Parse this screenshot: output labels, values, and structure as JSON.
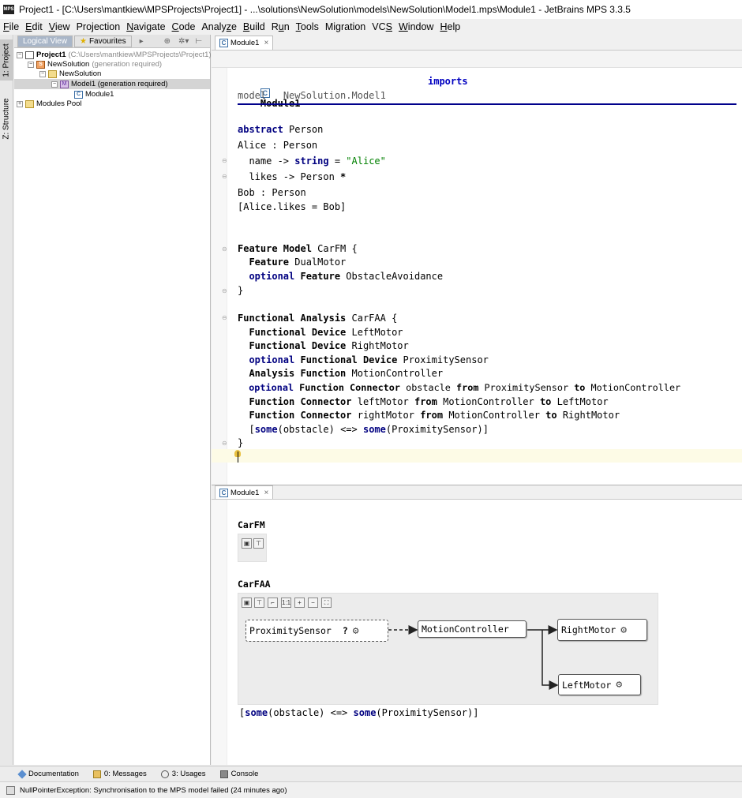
{
  "window": {
    "app_icon": "MPS",
    "title": "Project1 - [C:\\Users\\mantkiew\\MPSProjects\\Project1] - ...\\solutions\\NewSolution\\models\\NewSolution\\Model1.mps\\Module1 - JetBrains MPS 3.3.5"
  },
  "menu": [
    {
      "mn": "F",
      "rest": "ile"
    },
    {
      "mn": "E",
      "rest": "dit"
    },
    {
      "mn": "V",
      "rest": "iew"
    },
    {
      "pre": "Projection",
      "mn": "",
      "rest": ""
    },
    {
      "mn": "N",
      "rest": "avigate"
    },
    {
      "mn": "C",
      "rest": "ode"
    },
    {
      "pre": "Analy",
      "mn": "z",
      "rest": "e"
    },
    {
      "mn": "B",
      "rest": "uild"
    },
    {
      "pre": "R",
      "mn": "u",
      "rest": "n"
    },
    {
      "mn": "T",
      "rest": "ools"
    },
    {
      "pre": "Migration",
      "mn": "",
      "rest": ""
    },
    {
      "pre": "VC",
      "mn": "S",
      "rest": ""
    },
    {
      "mn": "W",
      "rest": "indow"
    },
    {
      "mn": "H",
      "rest": "elp"
    }
  ],
  "left_strip": {
    "project_tab": "1: Project",
    "structure_tab": "Z: Structure"
  },
  "project_panel": {
    "tabs": {
      "logical": "Logical View",
      "favourites": "Favourites"
    },
    "tools": {
      "nav": "▸",
      "locate": "⊕",
      "settings": "✲▾",
      "hide": "⊢"
    },
    "tree": {
      "project": {
        "name": "Project1",
        "path": "(C:\\Users\\mantkiew\\MPSProjects\\Project1)"
      },
      "solution": {
        "name": "NewSolution",
        "note": "(generation required)",
        "icon_letter": "S"
      },
      "folder": {
        "name": "NewSolution"
      },
      "model": {
        "name": "Model1 (generation required)",
        "icon_letter": "M"
      },
      "module": {
        "name": "Module1",
        "icon_letter": "C"
      },
      "modules_pool": {
        "name": "Modules Pool"
      }
    }
  },
  "editor_top": {
    "tab_label": "Module1",
    "tab_icon": "C",
    "close": "×",
    "header": {
      "name": "Module1",
      "imports": "imports",
      "model_kw": "model",
      "model_name": "NewSolution.Model1"
    },
    "lines": {
      "l1_kw": "abstract",
      "l1_rest": " Person",
      "l2": "Alice : Person",
      "l3_a": "  name -> ",
      "l3_kw": "string",
      "l3_b": " = ",
      "l3_str": "\"Alice\"",
      "l4_a": "  likes -> Person ",
      "l4_star": "*",
      "l5": "Bob : Person",
      "l6": "[Alice.likes = Bob]",
      "fm1_kw": "Feature Model",
      "fm1_rest": " CarFM {",
      "fm2_kw": "  Feature",
      "fm2_rest": " DualMotor",
      "fm3_opt": "  optional",
      "fm3_kw": " Feature",
      "fm3_rest": " ObstacleAvoidance",
      "fm4": "}",
      "fa1_kw": "Functional Analysis",
      "fa1_rest": " CarFAA {",
      "fa2_kw": "  Functional Device",
      "fa2_rest": " LeftMotor",
      "fa3_kw": "  Functional Device",
      "fa3_rest": " RightMotor",
      "fa4_opt": "  optional",
      "fa4_kw": " Functional Device",
      "fa4_rest": " ProximitySensor",
      "fa5_kw": "  Analysis Function",
      "fa5_rest": " MotionController",
      "fa6_opt": "  optional",
      "fa6_kw": " Function Connector",
      "fa6_a": " obstacle ",
      "fa6_from": "from",
      "fa6_b": " ProximitySensor ",
      "fa6_to": "to",
      "fa6_c": " MotionController",
      "fa7_kw": "  Function Connector",
      "fa7_a": " leftMotor ",
      "fa7_from": "from",
      "fa7_b": " MotionController ",
      "fa7_to": "to",
      "fa7_c": " LeftMotor",
      "fa8_kw": "  Function Connector",
      "fa8_a": " rightMotor ",
      "fa8_from": "from",
      "fa8_b": " MotionController ",
      "fa8_to": "to",
      "fa8_c": " RightMotor",
      "fa9_a": "  [",
      "fa9_some1": "some",
      "fa9_b": "(obstacle) <=> ",
      "fa9_some2": "some",
      "fa9_c": "(ProximitySensor)]",
      "fa10": "}"
    }
  },
  "editor_bottom": {
    "tab_label": "Module1",
    "tab_icon": "C",
    "close": "×",
    "carfm_title": "CarFM",
    "carfaa_title": "CarFAA",
    "nodes": {
      "proximity": "ProximitySensor",
      "proximity_flag": "?",
      "motion": "MotionController",
      "right": "RightMotor",
      "left": "LeftMotor"
    },
    "constraint": {
      "a": "[",
      "some1": "some",
      "b": "(obstacle) <=> ",
      "some2": "some",
      "c": "(ProximitySensor)]"
    }
  },
  "bottom_tools": {
    "documentation": "Documentation",
    "messages": "0: Messages",
    "usages": "3: Usages",
    "console": "Console"
  },
  "status": {
    "message": "NullPointerException: Synchronisation to the MPS model failed (24 minutes ago)"
  },
  "colors": {
    "keyword": "#000080",
    "string": "#008000",
    "header_rule": "#00008b",
    "selection": "#d4d4d4",
    "caret_line": "#fdfbe6"
  }
}
